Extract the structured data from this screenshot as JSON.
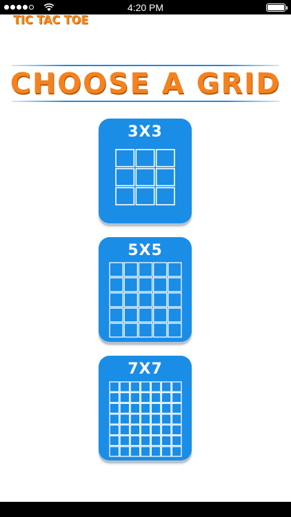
{
  "status_bar": {
    "time": "4:20 PM",
    "signal_icon": "signal-dots-icon",
    "wifi_icon": "wifi-icon",
    "battery_icon": "battery-icon"
  },
  "app": {
    "logo_text": "TIC TAC TOE"
  },
  "page": {
    "title": "CHOOSE A GRID"
  },
  "grid_options": [
    {
      "label": "3X3",
      "size": 3
    },
    {
      "label": "5X5",
      "size": 5
    },
    {
      "label": "7X7",
      "size": 7
    }
  ],
  "colors": {
    "accent_orange": "#f5821e",
    "card_blue": "#1a8de6",
    "line_blue": "#1e88e5"
  }
}
